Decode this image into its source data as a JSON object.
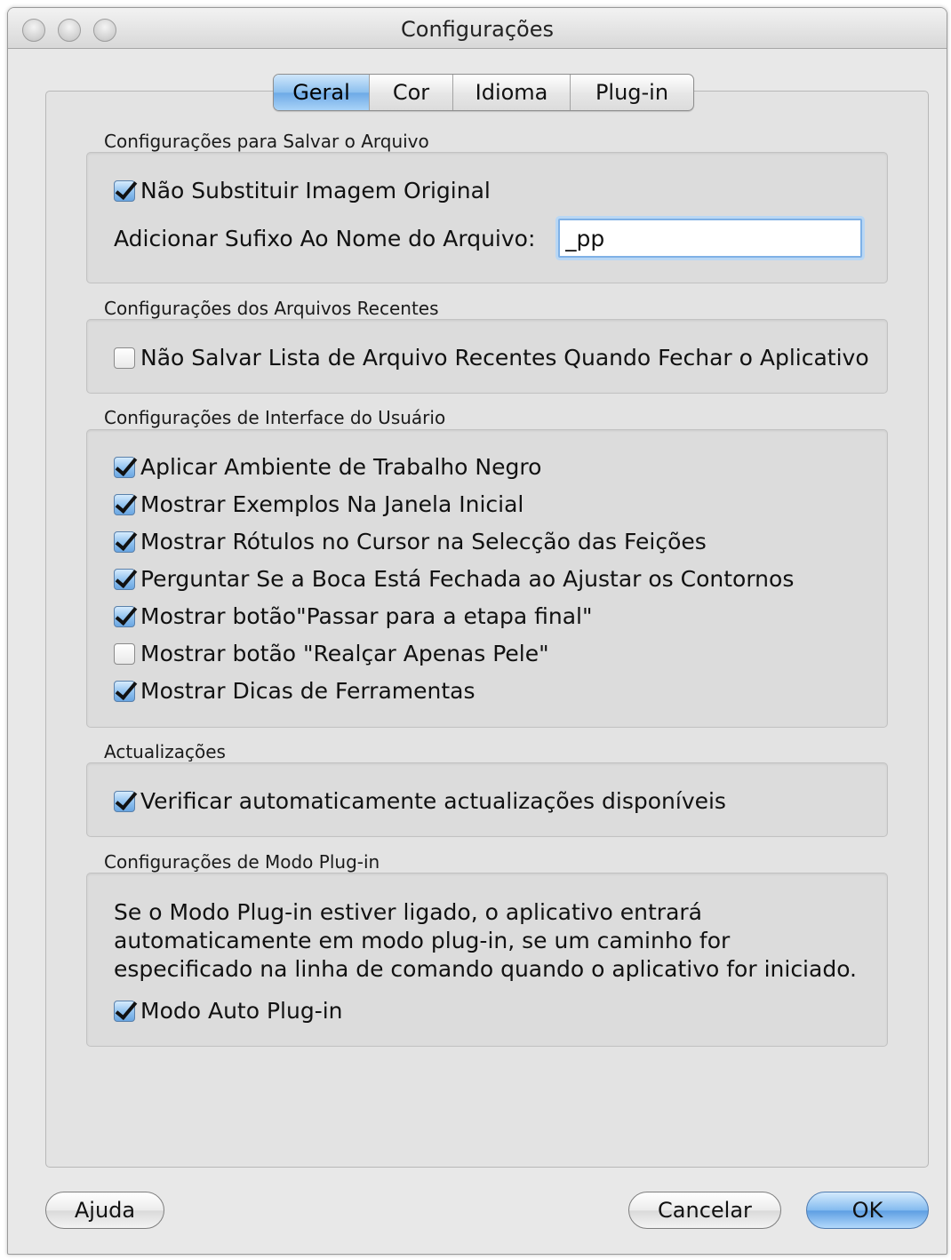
{
  "window": {
    "title": "Configurações"
  },
  "tabs": [
    {
      "label": "Geral",
      "active": true
    },
    {
      "label": "Cor",
      "active": false
    },
    {
      "label": "Idioma",
      "active": false
    },
    {
      "label": "Plug-in",
      "active": false
    }
  ],
  "save_settings": {
    "title": "Configurações para Salvar o Arquivo",
    "dont_replace_original": {
      "label": "Não Substituir Imagem Original",
      "checked": true
    },
    "suffix": {
      "label": "Adicionar Sufixo Ao Nome do Arquivo:",
      "value": "_pp"
    }
  },
  "recent_files": {
    "title": "Configurações dos Arquivos Recentes",
    "dont_save_list": {
      "label": "Não Salvar Lista de Arquivo Recentes Quando Fechar o Aplicativo",
      "checked": false
    }
  },
  "ui_settings": {
    "title": "Configurações de Interface do Usuário",
    "options": [
      {
        "label": "Aplicar Ambiente de Trabalho Negro",
        "checked": true
      },
      {
        "label": "Mostrar Exemplos Na Janela Inicial",
        "checked": true
      },
      {
        "label": "Mostrar Rótulos no Cursor na Selecção das Feições",
        "checked": true
      },
      {
        "label": "Perguntar Se a Boca Está Fechada ao Ajustar os Contornos",
        "checked": true
      },
      {
        "label": "Mostrar botão\"Passar para a etapa final\"",
        "checked": true
      },
      {
        "label": "Mostrar botão \"Realçar Apenas Pele\"",
        "checked": false
      },
      {
        "label": "Mostrar Dicas de Ferramentas",
        "checked": true
      }
    ]
  },
  "updates": {
    "title": "Actualizações",
    "auto_check": {
      "label": "Verificar automaticamente actualizações disponíveis",
      "checked": true
    }
  },
  "plugin_mode": {
    "title": "Configurações de Modo Plug-in",
    "description_lines": [
      "Se o Modo Plug-in estiver ligado, o aplicativo entrará",
      "automaticamente em modo plug-in, se um caminho for",
      "especificado na linha de comando quando o aplicativo for iniciado."
    ],
    "auto_plugin": {
      "label": "Modo Auto Plug-in",
      "checked": true
    }
  },
  "buttons": {
    "help": "Ajuda",
    "cancel": "Cancelar",
    "ok": "OK"
  },
  "colors": {
    "accent": "#6eaae6",
    "window_bg": "#e8e8e8",
    "group_bg": "#dcdcdc"
  }
}
